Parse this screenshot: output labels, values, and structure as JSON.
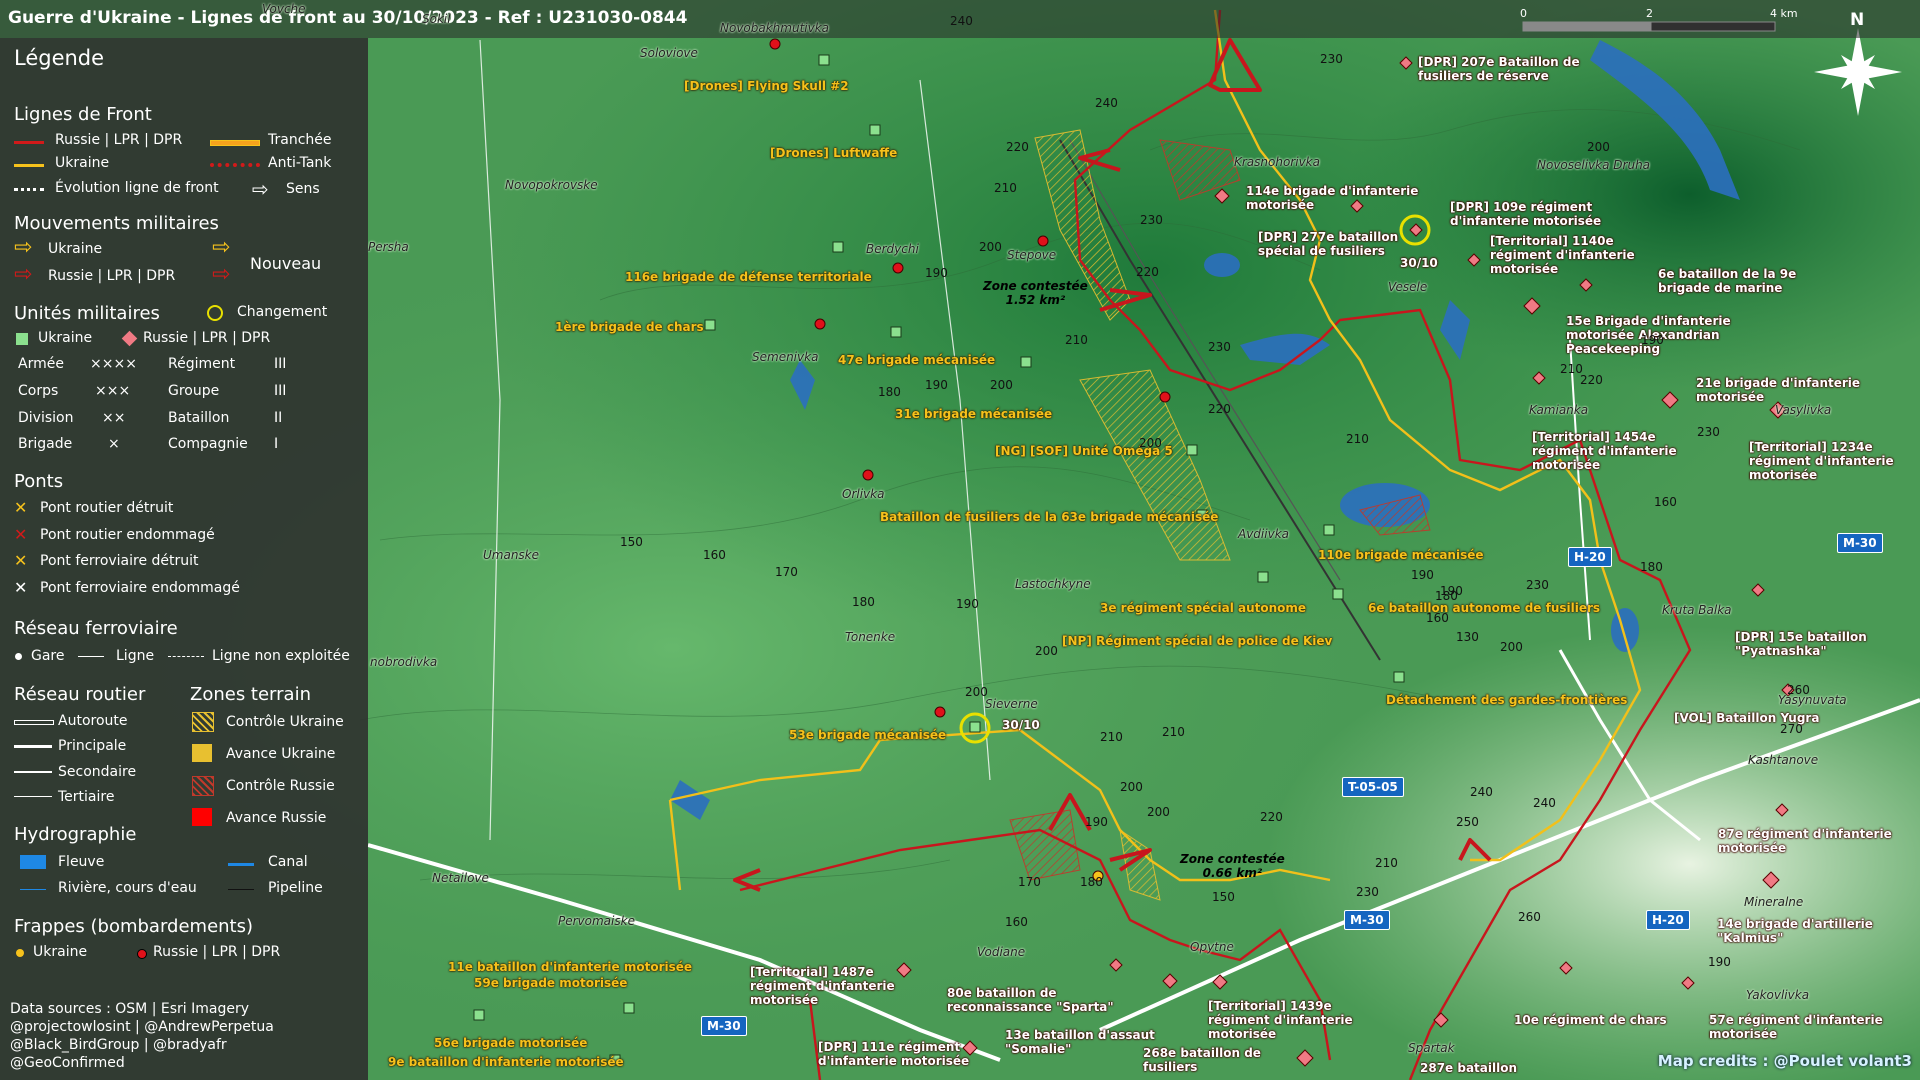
{
  "title": "Guerre d'Ukraine - Lignes de front au 30/10/2023 - Ref : U231030-0844",
  "scale": {
    "zero": "0",
    "mid": "2",
    "end": "4 km"
  },
  "north": "N",
  "legend": {
    "heading": "Légende",
    "front": {
      "title": "Lignes de Front",
      "russia": "Russie | LPR | DPR",
      "ukraine": "Ukraine",
      "evolution": "Évolution ligne de front",
      "trench": "Tranchée",
      "antitank": "Anti-Tank",
      "direction": "Sens"
    },
    "moves": {
      "title": "Mouvements militaires",
      "ukraine": "Ukraine",
      "russia": "Russie | LPR | DPR",
      "new": "Nouveau"
    },
    "units": {
      "title": "Unités militaires",
      "change": "Changement",
      "ukraine": "Ukraine",
      "russia": "Russie | LPR | DPR",
      "rows": [
        {
          "a": "Armée",
          "as": "××××",
          "b": "Régiment",
          "bs": "III"
        },
        {
          "a": "Corps",
          "as": "×××",
          "b": "Groupe",
          "bs": "III"
        },
        {
          "a": "Division",
          "as": "××",
          "b": "Bataillon",
          "bs": "II"
        },
        {
          "a": "Brigade",
          "as": "×",
          "b": "Compagnie",
          "bs": "I"
        }
      ]
    },
    "bridges": {
      "title": "Ponts",
      "items": [
        "Pont routier détruit",
        "Pont routier endommagé",
        "Pont ferroviaire détruit",
        "Pont ferroviaire endommagé"
      ]
    },
    "rail": {
      "title": "Réseau ferroviaire",
      "station": "Gare",
      "line": "Ligne",
      "unused": "Ligne non exploitée"
    },
    "roads": {
      "title": "Réseau routier",
      "items": [
        "Autoroute",
        "Principale",
        "Secondaire",
        "Tertiaire"
      ]
    },
    "zones": {
      "title": "Zones terrain",
      "items": [
        "Contrôle Ukraine",
        "Avance Ukraine",
        "Contrôle Russie",
        "Avance Russie"
      ]
    },
    "hydro": {
      "title": "Hydrographie",
      "river": "Fleuve",
      "canal": "Canal",
      "stream": "Rivière, cours d'eau",
      "pipeline": "Pipeline"
    },
    "strikes": {
      "title": "Frappes (bombardements)",
      "ukraine": "Ukraine",
      "russia": "Russie | LPR | DPR"
    },
    "credits": [
      "Data sources : OSM | Esri Imagery",
      "@projectowlosint | @AndrewPerpetua",
      "@Black_BirdGroup | @bradyafr",
      "@GeoConfirmed"
    ]
  },
  "towns": [
    "Vovche",
    "Sokil",
    "Novobakhmutivka",
    "Soloviove",
    "Novopokrovske",
    "Persha",
    "Berdychi",
    "Stepove",
    "Semenivka",
    "Orlivka",
    "Umanske",
    "Lastochkyne",
    "Tonenke",
    "Sieverne",
    "Netailove",
    "Pervomaiske",
    "Vodiane",
    "Opytne",
    "Krasnohorivka",
    "Novoselivka Druha",
    "Veselе",
    "Kamianka",
    "Avdiivka",
    "Vasylivka",
    "Kruta Balka",
    "Yasynuvata",
    "Kashtanove",
    "Mineralne",
    "Yakovlivka",
    "Spartak",
    "nobrodivka"
  ],
  "ukraine_units": [
    "[Drones] Flying Skull #2",
    "[Drones] Luftwaffe",
    "116e brigade de défense territoriale",
    "1ère brigade de chars",
    "47e brigade mécanisée",
    "31e brigade mécanisée",
    "[NG] [SOF] Unité Oméga 5",
    "Bataillon de fusiliers de la 63e brigade mécanisée",
    "110e brigade mécanisée",
    "3e régiment spécial autonome",
    "6e bataillon autonome de fusiliers",
    "[NP] Régiment spécial de police de Kiev",
    "Détachement des gardes-frontières",
    "53e brigade mécanisée",
    "11e bataillon d'infanterie motorisée",
    "59e brigade motorisée",
    "56e brigade motorisée",
    "9e bataillon d'infanterie motorisée"
  ],
  "russia_units": [
    "[DPR] 207e Bataillon de\nfusiliers de réserve",
    "114e brigade d'infanterie\nmotorisée",
    "[DPR] 277e bataillon\nspécial de fusiliers",
    "[DPR] 109e régiment\nd'infanterie motorisée",
    "[Territorial] 1140e\nrégiment d'infanterie\nmotorisée",
    "6e bataillon de la 9e\nbrigade de marine",
    "15e Brigade d'infanterie\nmotorisée Alexandrian\nPeacekeeping",
    "21e brigade d'infanterie\nmotorisée",
    "[Territorial] 1454e\nrégiment d'infanterie\nmotorisée",
    "[Territorial] 1234e\nrégiment d'infanterie\nmotorisée",
    "[DPR] 15e bataillon\n\"Pyatnashka\"",
    "[VOL] Bataillon Yugra",
    "87e régiment d'infanterie\nmotorisée",
    "14e brigade d'artillerie\n\"Kalmius\"",
    "[Territorial] 1487e\nrégiment d'infanterie\nmotorisée",
    "80e bataillon de\nreconnaissance \"Sparta\"",
    "13e bataillon d'assaut\n\"Somalie\"",
    "[DPR] 111e régiment\nd'infanterie motorisée",
    "268e bataillon de\nfusiliers",
    "[Territorial] 1439e\nrégiment d'infanterie\nmotorisée",
    "10e régiment de chars",
    "57e régiment d'infanterie\nmotorisée",
    "287e bataillon"
  ],
  "zones": [
    {
      "name": "Zone contestée",
      "area": "1.52 km²"
    },
    {
      "name": "Zone contestée",
      "area": "0.66 km²"
    }
  ],
  "change_dates": [
    "30/10",
    "30/10"
  ],
  "roads": [
    "M-30",
    "M-30",
    "M-30",
    "H-20",
    "H-20",
    "T-05-05"
  ],
  "altitudes": [
    "240",
    "230",
    "240",
    "220",
    "210",
    "200",
    "190",
    "230",
    "220",
    "210",
    "200",
    "190",
    "180",
    "200",
    "230",
    "220",
    "210",
    "150",
    "160",
    "170",
    "180",
    "190",
    "200",
    "200",
    "210",
    "200",
    "190",
    "180",
    "170",
    "160",
    "150",
    "210",
    "200",
    "220",
    "240",
    "250",
    "260",
    "230",
    "210",
    "200",
    "190",
    "180",
    "160",
    "130",
    "180",
    "200",
    "190",
    "210",
    "220",
    "230",
    "160",
    "190",
    "230",
    "240",
    "260",
    "270",
    "190"
  ],
  "map_credit": "Map credits : @Poulet volant3",
  "colors": {
    "ukraine": "#f6c21c",
    "russia": "#d11a1a",
    "water": "#2b6fbf",
    "panel": "#2d2d2d"
  }
}
